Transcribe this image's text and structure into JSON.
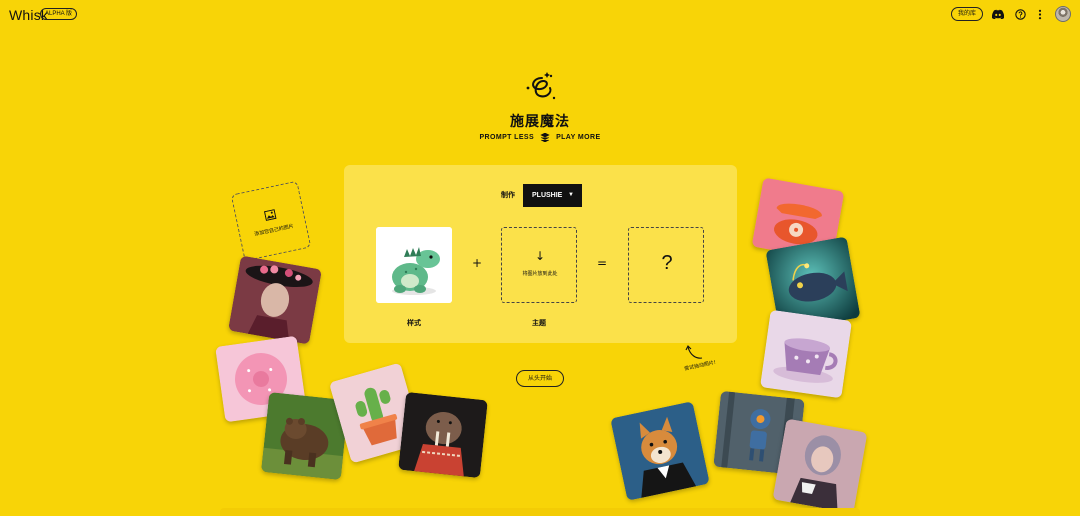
{
  "header": {
    "brand": "Whisk",
    "badge": "ALPHA 版",
    "library_button": "我的库",
    "icons": [
      "discord-icon",
      "help-icon",
      "more-vertical-icon",
      "avatar"
    ]
  },
  "hero": {
    "title": "施展魔法",
    "tagline_left": "PROMPT LESS",
    "tagline_right": "PLAY MORE"
  },
  "panel": {
    "make_label": "制作",
    "mode_selected": "PLUSHIE",
    "plus": "+",
    "equals": "=",
    "subject_drop_text": "将图片放到此处",
    "subject_drop_arrow": "↓",
    "result_placeholder": "?",
    "style_caption": "样式",
    "subject_caption": "主题"
  },
  "add_image_tile": {
    "label": "添加您自己的图片"
  },
  "hint_text": "尝试拖动图片!",
  "restart_button": "从头开始",
  "colors": {
    "background": "#f8d407",
    "panel": "#fbe14a",
    "dropdown": "#111111"
  },
  "tiles": [
    "pink-hat-man",
    "pink-donut",
    "grizzly-bear",
    "cactus-pot",
    "walrus-sweater",
    "orange-telephone",
    "anglerfish",
    "purple-teacup",
    "shiba-tuxedo",
    "robot-forest",
    "woman-teacup"
  ]
}
